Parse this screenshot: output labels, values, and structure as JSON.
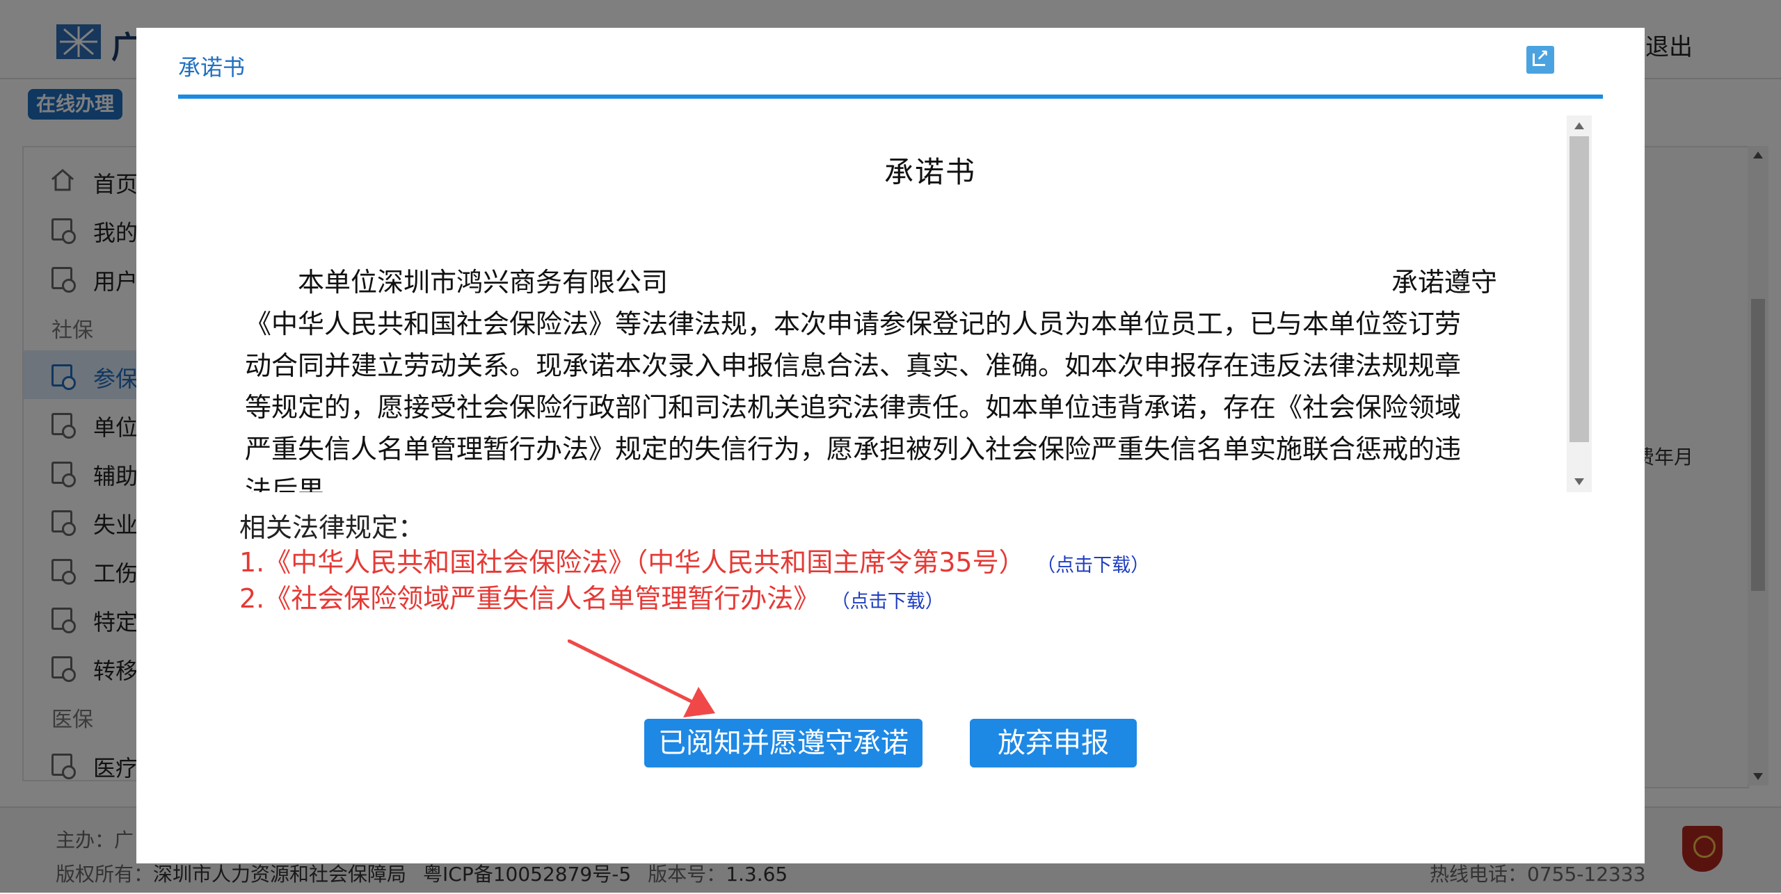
{
  "header": {
    "site_char": "广",
    "logout_label": "退出"
  },
  "online_badge": "在线办理",
  "sidebar": {
    "items": [
      {
        "label": "首页"
      },
      {
        "label": "我的"
      },
      {
        "label": "用户"
      },
      {
        "label": "参保"
      },
      {
        "label": "单位"
      },
      {
        "label": "辅助"
      },
      {
        "label": "失业"
      },
      {
        "label": "工伤"
      },
      {
        "label": "特定"
      },
      {
        "label": "转移"
      },
      {
        "label": "医疗"
      }
    ],
    "categories": [
      "社保",
      "医保"
    ],
    "active_item": "参保"
  },
  "main": {
    "fragment_text": "费年月"
  },
  "footer": {
    "line1": "主办：广",
    "copyright_label": "版权所有：",
    "copyright_value": "深圳市人力资源和社会保障局",
    "icp": "粤ICP备10052879号-5",
    "version_label": "版本号：",
    "version_value": "1.3.65",
    "hotline_label": "热线电话：",
    "hotline_value": "0755-12333"
  },
  "modal": {
    "title": "承诺书",
    "document": {
      "heading": "承诺书",
      "pledge_company": "本单位深圳市鸿兴商务有限公司",
      "pledge_right": "承诺遵守",
      "lines": [
        "《中华人民共和国社会保险法》等法律法规，本次申请参保登记的人员为本单位员工，已与本单位签订劳",
        "动合同并建立劳动关系。现承诺本次录入申报信息合法、真实、准确。如本次申报存在违反法律法规规章",
        "等规定的，愿接受社会保险行政部门和司法机关追究法律责任。如本单位违背承诺，存在《社会保险领域",
        "严重失信人名单管理暂行办法》规定的失信行为，愿承担被列入社会保险严重失信名单实施联合惩戒的违",
        "法后果"
      ]
    },
    "laws": {
      "heading": "相关法律规定：",
      "items": [
        {
          "text": "1.《中华人民共和国社会保险法》（中华人民共和国主席令第35号）",
          "download": "（点击下载）"
        },
        {
          "text": "2.《社会保险领域严重失信人名单管理暂行办法》",
          "download": "（点击下载）"
        }
      ]
    },
    "accept_label": "已阅知并愿遵守承诺",
    "abandon_label": "放弃申报",
    "annotation_arrow_color": "#f04848"
  }
}
